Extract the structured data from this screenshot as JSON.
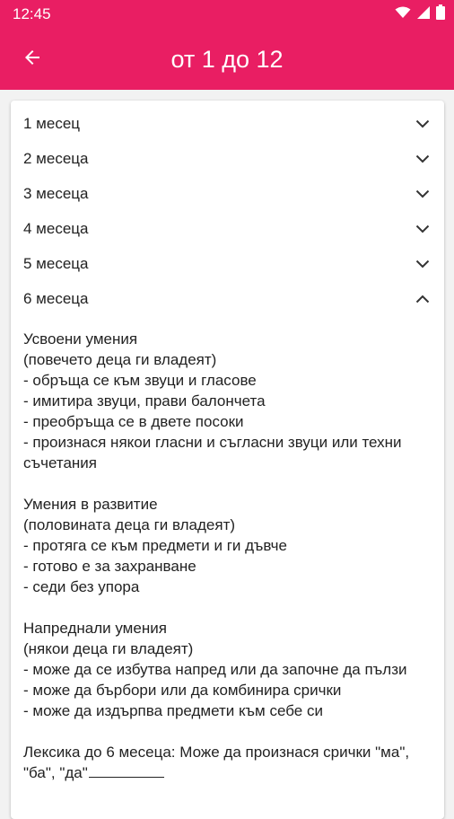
{
  "statusbar": {
    "time": "12:45"
  },
  "appbar": {
    "title": "от 1 до 12"
  },
  "colors": {
    "accent": "#e91e63"
  },
  "accordion": {
    "items": [
      {
        "label": "1 месец",
        "expanded": false
      },
      {
        "label": "2 месеца",
        "expanded": false
      },
      {
        "label": "3 месеца",
        "expanded": false
      },
      {
        "label": "4 месеца",
        "expanded": false
      },
      {
        "label": "5 месеца",
        "expanded": false
      },
      {
        "label": "6 месеца",
        "expanded": true
      }
    ]
  },
  "content": {
    "mastered": {
      "title": "Усвоени умения",
      "subtitle": "(повечето деца ги владеят)",
      "items": [
        "- обръща се към звуци и гласове",
        "- имитира звуци, прави балончета",
        "- преобръща се в двете посоки",
        "- произнася някои гласни и съгласни звуци или техни съчетания"
      ]
    },
    "developing": {
      "title": "Умения в развитие",
      "subtitle": "(половината деца ги владеят)",
      "items": [
        "- протяга се към предмети и ги дъвче",
        "- готово е за захранване",
        "- седи без упора"
      ]
    },
    "advanced": {
      "title": "Напреднали умения",
      "subtitle": "(някои деца ги владеят)",
      "items": [
        "- може да се избутва напред или да започне да пълзи",
        "- може да бърбори или да комбинира срички",
        "- може да издърпва предмети към себе си"
      ]
    },
    "lexicon": {
      "text": "Лексика до 6 месеца: Може да произнася срички \"ма\", \"ба\", \"да\""
    }
  }
}
